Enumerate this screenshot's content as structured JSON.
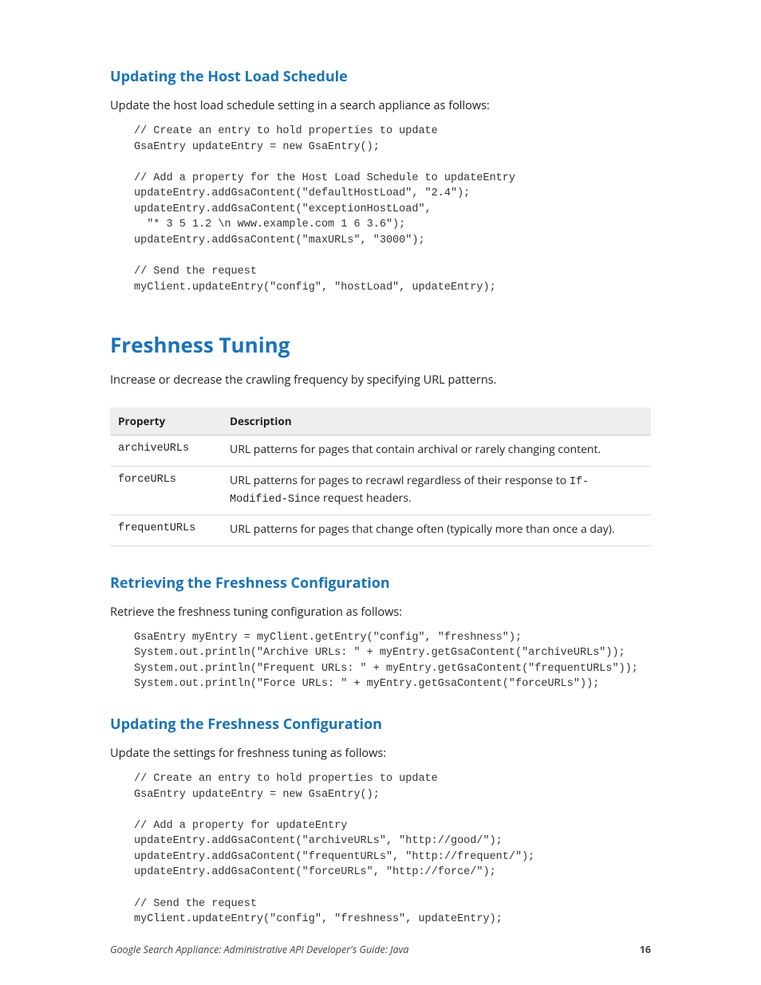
{
  "sections": {
    "s1": {
      "heading": "Updating the Host Load Schedule",
      "intro": "Update the host load schedule setting in a search appliance as follows:",
      "code": "// Create an entry to hold properties to update\nGsaEntry updateEntry = new GsaEntry();\n\n// Add a property for the Host Load Schedule to updateEntry\nupdateEntry.addGsaContent(\"defaultHostLoad\", \"2.4\");\nupdateEntry.addGsaContent(\"exceptionHostLoad\",\n  \"* 3 5 1.2 \\n www.example.com 1 6 3.6\");\nupdateEntry.addGsaContent(\"maxURLs\", \"3000\");\n\n// Send the request\nmyClient.updateEntry(\"config\", \"hostLoad\", updateEntry);"
    },
    "s2": {
      "heading": "Freshness Tuning",
      "intro": "Increase or decrease the crawling frequency by specifying URL patterns.",
      "table": {
        "headers": {
          "c1": "Property",
          "c2": "Description"
        },
        "rows": [
          {
            "prop": "archiveURLs",
            "desc_pre": "URL patterns for pages that contain archival or rarely changing content.",
            "code": "",
            "desc_post": ""
          },
          {
            "prop": "forceURLs",
            "desc_pre": "URL patterns for pages to recrawl regardless of their response to ",
            "code": "If-Modified-Since",
            "desc_post": " request headers."
          },
          {
            "prop": "frequentURLs",
            "desc_pre": "URL patterns for pages that change often (typically more than once a day).",
            "code": "",
            "desc_post": ""
          }
        ]
      }
    },
    "s3": {
      "heading": "Retrieving the Freshness Configuration",
      "intro": "Retrieve the freshness tuning configuration as follows:",
      "code": "GsaEntry myEntry = myClient.getEntry(\"config\", \"freshness\");\nSystem.out.println(\"Archive URLs: \" + myEntry.getGsaContent(\"archiveURLs\"));\nSystem.out.println(\"Frequent URLs: \" + myEntry.getGsaContent(\"frequentURLs\"));\nSystem.out.println(\"Force URLs: \" + myEntry.getGsaContent(\"forceURLs\"));"
    },
    "s4": {
      "heading": "Updating the Freshness Configuration",
      "intro": "Update the settings for freshness tuning as follows:",
      "code": "// Create an entry to hold properties to update\nGsaEntry updateEntry = new GsaEntry();\n\n// Add a property for updateEntry\nupdateEntry.addGsaContent(\"archiveURLs\", \"http://good/\");\nupdateEntry.addGsaContent(\"frequentURLs\", \"http://frequent/\");\nupdateEntry.addGsaContent(\"forceURLs\", \"http://force/\");\n\n// Send the request\nmyClient.updateEntry(\"config\", \"freshness\", updateEntry);"
    }
  },
  "footer": {
    "title": "Google Search Appliance: Administrative API Developer's Guide: Java",
    "page": "16"
  }
}
